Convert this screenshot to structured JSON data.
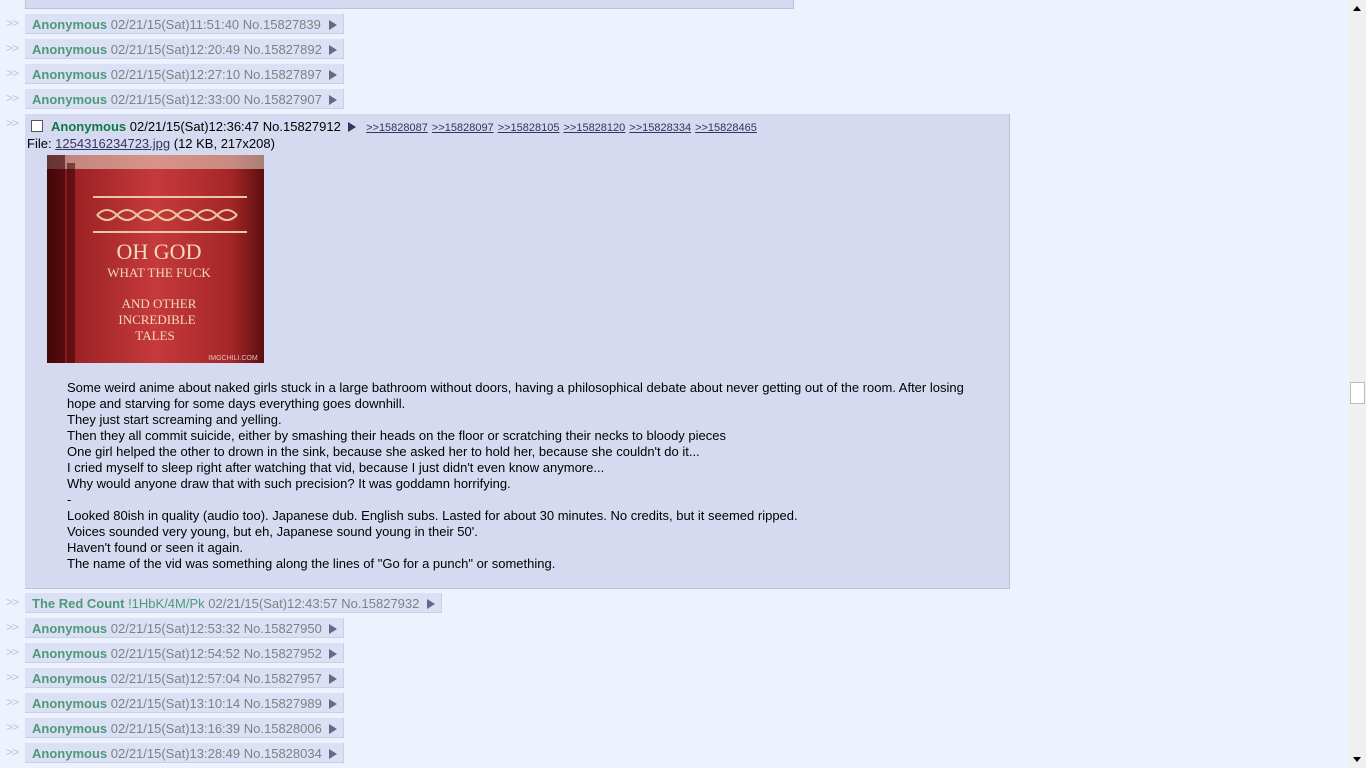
{
  "hidden_replies_above": [
    {
      "name": "Anonymous",
      "datetime": "02/21/15(Sat)11:51:40",
      "no": "No.15827839"
    },
    {
      "name": "Anonymous",
      "datetime": "02/21/15(Sat)12:20:49",
      "no": "No.15827892"
    },
    {
      "name": "Anonymous",
      "datetime": "02/21/15(Sat)12:27:10",
      "no": "No.15827897"
    },
    {
      "name": "Anonymous",
      "datetime": "02/21/15(Sat)12:33:00",
      "no": "No.15827907"
    }
  ],
  "arrows": ">>",
  "main_post": {
    "name": "Anonymous",
    "datetime": "02/21/15(Sat)12:36:47",
    "no": "No.15827912",
    "backlinks": [
      ">>15828087",
      ">>15828097",
      ">>15828105",
      ">>15828120",
      ">>15828334",
      ">>15828465"
    ],
    "file_label": "File: ",
    "file_name": "1254316234723.jpg",
    "file_info": " (12 KB, 217x208)",
    "image_text": {
      "line1": "OH GOD",
      "line2": "WHAT THE FUCK",
      "line3": "AND OTHER",
      "line4": "INCREDIBLE",
      "line5": "TALES",
      "watermark": "IMGCHILI.COM"
    },
    "message": [
      "Some weird anime about naked girls stuck in a large bathroom without doors, having a philosophical debate about never getting out of the room. After losing hope and starving for some days everything goes downhill.",
      "They just start screaming and yelling.",
      "Then they all commit suicide, either by smashing their heads on the floor or scratching their necks to bloody pieces",
      "One girl helped the other to drown in the sink, because she asked her to hold her, because she couldn't do it...",
      "I cried myself to sleep right after watching that vid, because I just didn't even know anymore...",
      "Why would anyone draw that with such precision? It was goddamn horrifying.",
      "-",
      "Looked 80ish in quality (audio too). Japanese dub. English subs. Lasted for about 30 minutes. No credits, but it seemed ripped.",
      "Voices sounded very young, but eh, Japanese sound young in their 50'.",
      "Haven't found or seen it again.",
      "The name of the vid was something along the lines of \"Go for a punch\" or something."
    ]
  },
  "hidden_replies_below": [
    {
      "name": "The Red Count",
      "trip": "!1HbK/4M/Pk",
      "datetime": "02/21/15(Sat)12:43:57",
      "no": "No.15827932"
    },
    {
      "name": "Anonymous",
      "trip": "",
      "datetime": "02/21/15(Sat)12:53:32",
      "no": "No.15827950"
    },
    {
      "name": "Anonymous",
      "trip": "",
      "datetime": "02/21/15(Sat)12:54:52",
      "no": "No.15827952"
    },
    {
      "name": "Anonymous",
      "trip": "",
      "datetime": "02/21/15(Sat)12:57:04",
      "no": "No.15827957"
    },
    {
      "name": "Anonymous",
      "trip": "",
      "datetime": "02/21/15(Sat)13:10:14",
      "no": "No.15827989"
    },
    {
      "name": "Anonymous",
      "trip": "",
      "datetime": "02/21/15(Sat)13:16:39",
      "no": "No.15828006"
    },
    {
      "name": "Anonymous",
      "trip": "",
      "datetime": "02/21/15(Sat)13:28:49",
      "no": "No.15828034"
    }
  ]
}
